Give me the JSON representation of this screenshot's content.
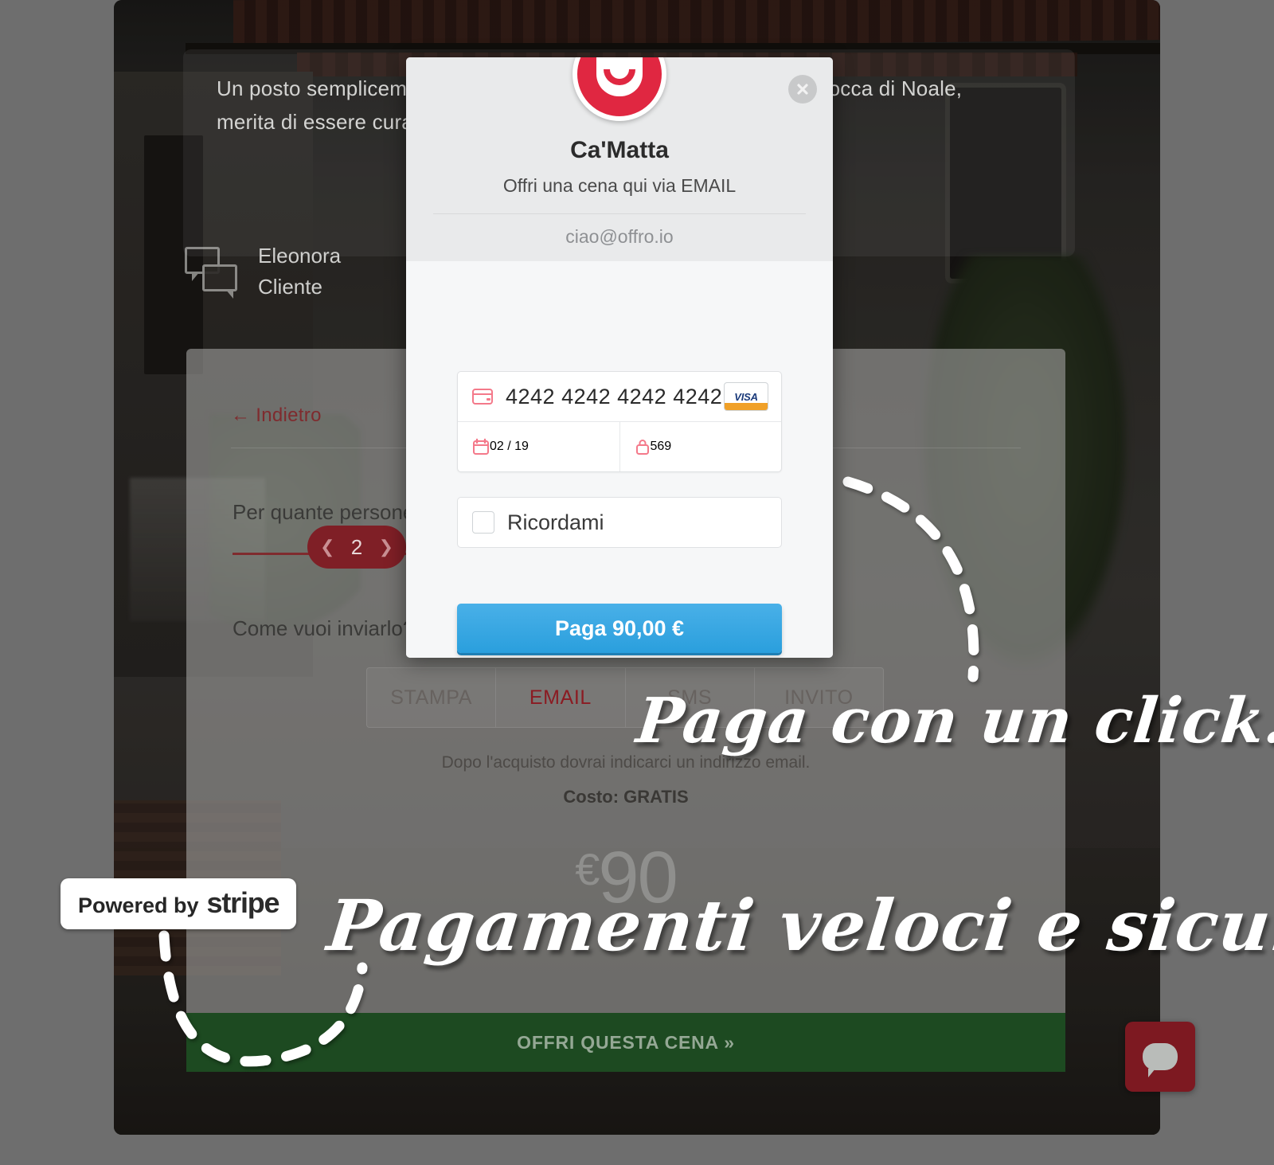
{
  "background": {
    "intro_text": "Un posto semplicemente magico, con un giardino con vista sulla rocca di Noale, merita di essere curato in ogni dettaglio con originalità!",
    "reviewer": {
      "name": "Eleonora",
      "role": "Cliente",
      "icon": "chat-bubbles-icon"
    },
    "panel": {
      "back_link": "← Indietro",
      "question_people": "Per quante persone?",
      "people_count": "2",
      "prev_icon": "chevron-left-icon",
      "next_icon": "chevron-right-icon",
      "question_delivery": "Come vuoi inviarlo?",
      "tabs": [
        {
          "label": "STAMPA",
          "active": false
        },
        {
          "label": "EMAIL",
          "active": true
        },
        {
          "label": "SMS",
          "active": false
        },
        {
          "label": "INVITO",
          "active": false
        }
      ],
      "note": "Dopo l'acquisto dovrai indicarci un indirizzo email.",
      "cost": "Costo: GRATIS",
      "price_currency": "€",
      "price_amount": "90",
      "cta": "OFFRI QUESTA CENA »"
    }
  },
  "modal": {
    "logo_icon": "smiley-bag-logo-icon",
    "close_icon": "close-circle-icon",
    "merchant": "Ca'Matta",
    "description": "Offri una cena qui via EMAIL",
    "email": "ciao@offro.io",
    "card": {
      "card_icon": "credit-card-icon",
      "number": "4242 4242 4242 4242",
      "brand_icon": "visa-icon",
      "brand_label": "VISA",
      "expiry_icon": "calendar-icon",
      "expiry": "02 / 19",
      "cvc_icon": "lock-icon",
      "cvc": "569"
    },
    "remember_label": "Ricordami",
    "remember_checked": false,
    "pay_button": "Paga 90,00 €"
  },
  "annotations": {
    "callout_top": "Paga con un click!",
    "callout_bottom": "Pagamenti veloci e sicuri",
    "stripe_badge_prefix": "Powered by",
    "stripe_badge_name": "stripe"
  },
  "chat_widget": {
    "icon": "chat-bubble-icon"
  },
  "colors": {
    "brand_red": "#e02741",
    "dark_red": "#7f1f26",
    "pay_blue": "#2a9fdd",
    "cta_green": "#1d4a21",
    "modal_bg": "#e9eaeb"
  }
}
